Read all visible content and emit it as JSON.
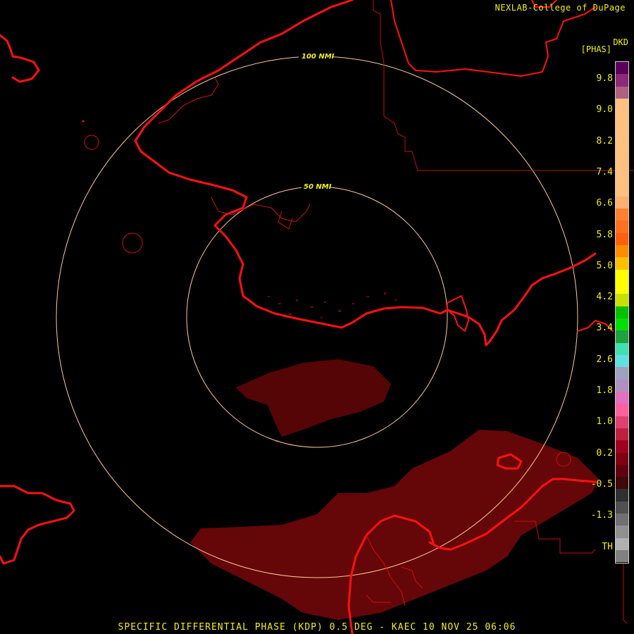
{
  "header": {
    "credit": "NEXLAB-College of DuPage",
    "product_code": "DKD",
    "unit": "[PHAS]"
  },
  "range_rings": [
    "100 NMI",
    "50 NMI"
  ],
  "color_scale": {
    "labels": [
      "9.8",
      "9.0",
      "8.2",
      "7.4",
      "6.6",
      "5.8",
      "5.0",
      "4.2",
      "3.4",
      "2.6",
      "1.8",
      "1.0",
      "0.2",
      "-0.5",
      "-1.3",
      "TH"
    ],
    "colors": [
      "#5a005a",
      "#8a2a7a",
      "#b06080",
      "#ffc080",
      "#ffc080",
      "#ffc080",
      "#ffc080",
      "#ffc080",
      "#ffc080",
      "#ffc080",
      "#ffc080",
      "#ffb070",
      "#ff8030",
      "#ff7020",
      "#ff6010",
      "#ff8c00",
      "#ffc000",
      "#ffff00",
      "#ffff00",
      "#c8e000",
      "#00c000",
      "#00e000",
      "#20a040",
      "#40e0b0",
      "#60e0e0",
      "#a0a0c0",
      "#b090c0",
      "#e070c0",
      "#ff60a0",
      "#e04070",
      "#c02040",
      "#a00020",
      "#800010",
      "#600010",
      "#400808",
      "#303030",
      "#505050",
      "#707070",
      "#909090",
      "#b0b0b0",
      "#808080"
    ]
  },
  "footer": {
    "title": "SPECIFIC DIFFERENTIAL PHASE (KDP) 0.5 DEG - KAEC 10 NOV 25 06:06"
  },
  "colors": {
    "background": "#000000",
    "coastline": "#ff1010",
    "border": "#c01010",
    "ring": "#ffc890",
    "echo": "#6a0608",
    "text": "#f4f000"
  }
}
